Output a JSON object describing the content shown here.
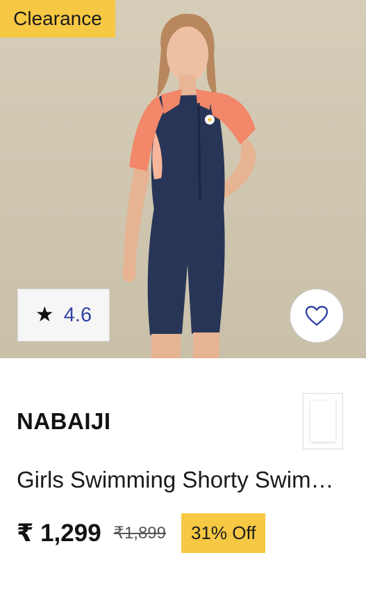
{
  "badges": {
    "clearance": "Clearance",
    "discount": "31% Off"
  },
  "rating": {
    "value": "4.6",
    "icon": "star-icon"
  },
  "wishlist": {
    "icon": "heart-icon"
  },
  "product": {
    "brand": "NABAIJI",
    "title": "Girls Swimming Shorty Swim…",
    "price": "₹ 1,299",
    "mrp": "₹1,899"
  },
  "colors": {
    "badge": "#f6c843",
    "rating_text": "#3343a3",
    "swimsuit_navy": "#283556",
    "swimsuit_sleeve": "#f2876a",
    "background": "#d3cab4"
  }
}
